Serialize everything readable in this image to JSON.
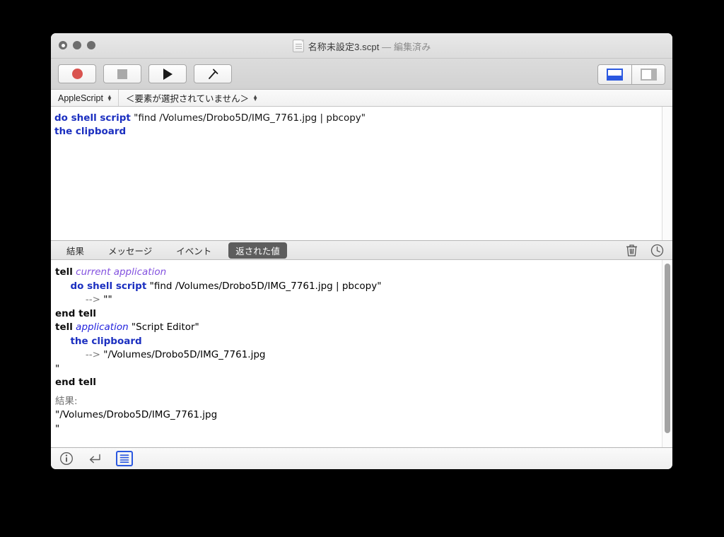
{
  "window": {
    "title": "名称未設定3.scpt",
    "title_separator": "—",
    "title_modified": "編集済み",
    "doc_icon": "script-document-icon",
    "traffic_lights": [
      {
        "name": "close",
        "icon": "close-window-button"
      },
      {
        "name": "minimize",
        "icon": "minimize-window-button"
      },
      {
        "name": "zoom",
        "icon": "zoom-window-button"
      }
    ]
  },
  "toolbar": {
    "buttons": [
      {
        "name": "record",
        "icon": "record-circle-icon",
        "label": ""
      },
      {
        "name": "stop",
        "icon": "stop-square-icon",
        "label": ""
      },
      {
        "name": "run",
        "icon": "run-triangle-icon",
        "label": ""
      },
      {
        "name": "compile",
        "icon": "hammer-icon",
        "label": ""
      }
    ],
    "view_toggles": [
      {
        "name": "bottom-pane",
        "icon": "bottom-pane-icon",
        "active": true
      },
      {
        "name": "side-pane",
        "icon": "side-pane-icon",
        "active": false
      }
    ],
    "accent_color": "#2b58e0",
    "record_color": "#d9534f"
  },
  "popup_bar": {
    "language": "AppleScript",
    "element_selector": "＜要素が選択されていません＞"
  },
  "editor": {
    "lines": [
      {
        "tokens": [
          {
            "text": "do shell script",
            "style": "kw"
          },
          {
            "text": " \"find /Volumes/Drobo5D/IMG_7761.jpg | pbcopy\"",
            "style": "str"
          }
        ]
      },
      {
        "tokens": [
          {
            "text": "the clipboard",
            "style": "kw"
          }
        ]
      }
    ],
    "plain_text": "do shell script \"find /Volumes/Drobo5D/IMG_7761.jpg | pbcopy\"\nthe clipboard"
  },
  "log": {
    "tabs": [
      {
        "label": "結果",
        "name": "tab-result",
        "active": false
      },
      {
        "label": "メッセージ",
        "name": "tab-messages",
        "active": false
      },
      {
        "label": "イベント",
        "name": "tab-events",
        "active": false
      },
      {
        "label": "返された値",
        "name": "tab-returned-values",
        "active": true
      }
    ],
    "actions": [
      {
        "name": "clear-log-button",
        "icon": "trash-icon"
      },
      {
        "name": "log-history-button",
        "icon": "clock-icon"
      }
    ],
    "entries": [
      {
        "indent": 0,
        "parts": [
          {
            "text": "tell",
            "style": "b"
          },
          {
            "text": " ",
            "style": "plain"
          },
          {
            "text": "current application",
            "style": "ip"
          }
        ]
      },
      {
        "indent": 1,
        "parts": [
          {
            "text": "do shell script",
            "style": "kb"
          },
          {
            "text": " \"find /Volumes/Drobo5D/IMG_7761.jpg | pbcopy\"",
            "style": "plain"
          }
        ]
      },
      {
        "indent": 2,
        "parts": [
          {
            "text": "-->",
            "style": "ar"
          },
          {
            "text": " \"\"",
            "style": "plain"
          }
        ]
      },
      {
        "indent": 0,
        "parts": [
          {
            "text": "end tell",
            "style": "b"
          }
        ]
      },
      {
        "indent": 0,
        "parts": [
          {
            "text": "tell",
            "style": "b"
          },
          {
            "text": " ",
            "style": "plain"
          },
          {
            "text": "application",
            "style": "ib"
          },
          {
            "text": " \"Script Editor\"",
            "style": "plain"
          }
        ]
      },
      {
        "indent": 1,
        "parts": [
          {
            "text": "the clipboard",
            "style": "kb"
          }
        ]
      },
      {
        "indent": 2,
        "parts": [
          {
            "text": "-->",
            "style": "ar"
          },
          {
            "text": " \"/Volumes/Drobo5D/IMG_7761.jpg",
            "style": "plain"
          }
        ]
      },
      {
        "indent": 0,
        "parts": [
          {
            "text": "\"",
            "style": "plain"
          }
        ]
      },
      {
        "indent": 0,
        "parts": [
          {
            "text": "end tell",
            "style": "b"
          }
        ]
      }
    ],
    "result_label": "結果:",
    "result_value_line1": "\"/Volumes/Drobo5D/IMG_7761.jpg",
    "result_value_line2": "\"",
    "scrollbar": {
      "name": "log-scrollbar"
    }
  },
  "status_bar": {
    "items": [
      {
        "name": "info-button",
        "icon": "info-circle-icon",
        "active": false
      },
      {
        "name": "return-button",
        "icon": "return-arrow-icon",
        "active": false
      },
      {
        "name": "log-lines-button",
        "icon": "lines-list-icon",
        "active": true
      }
    ]
  }
}
